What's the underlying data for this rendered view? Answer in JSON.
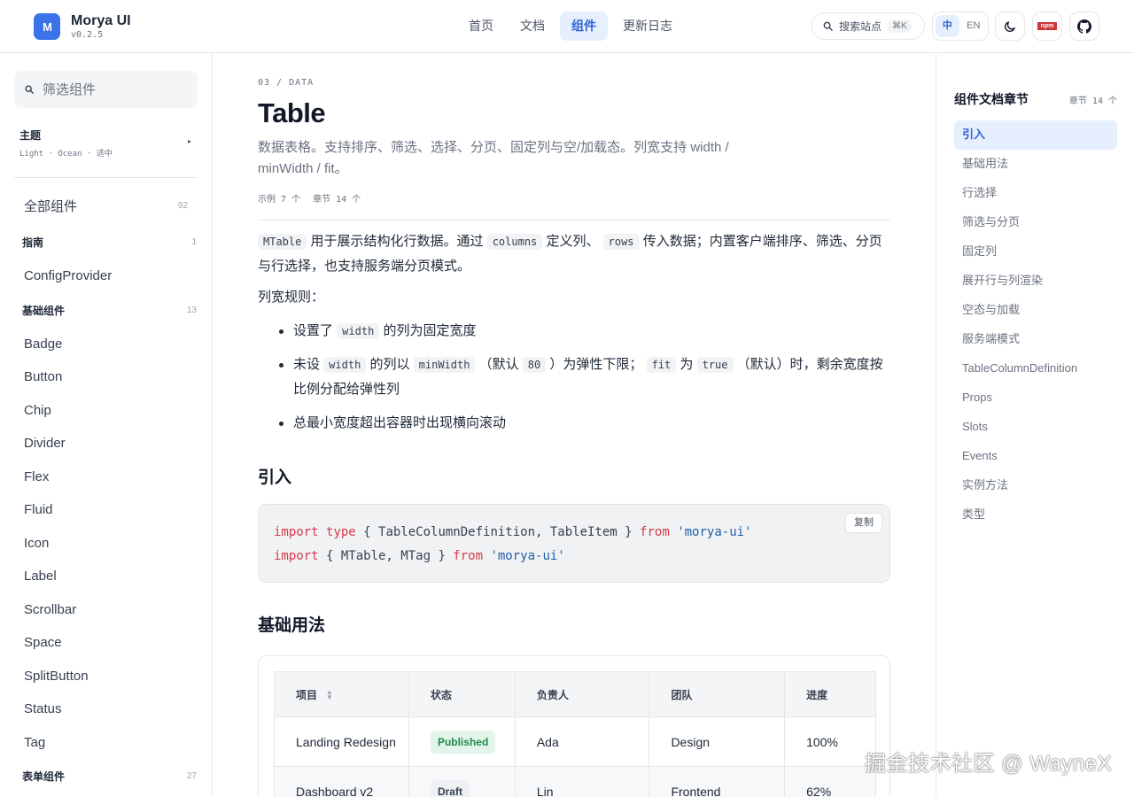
{
  "brand": {
    "logo": "M",
    "name": "Morya UI",
    "version": "v0.2.5"
  },
  "nav": [
    {
      "label": "首页",
      "active": false
    },
    {
      "label": "文档",
      "active": false
    },
    {
      "label": "组件",
      "active": true
    },
    {
      "label": "更新日志",
      "active": false
    }
  ],
  "search": {
    "label": "搜索站点",
    "shortcut": "⌘K"
  },
  "lang": {
    "zh": "中",
    "en": "EN"
  },
  "icons": {
    "theme": "moon-icon",
    "npm": "npm",
    "github": "github-icon"
  },
  "sidebar": {
    "filter_placeholder": "筛选组件",
    "theme_title": "主题",
    "theme_sub": "Light · Ocean · 适中",
    "all": {
      "label": "全部组件",
      "count": "92"
    },
    "groups": [
      {
        "label": "指南",
        "count": "1",
        "items": [
          "ConfigProvider"
        ]
      },
      {
        "label": "基础组件",
        "count": "13",
        "items": [
          "Badge",
          "Button",
          "Chip",
          "Divider",
          "Flex",
          "Fluid",
          "Icon",
          "Label",
          "Scrollbar",
          "Space",
          "SplitButton",
          "Status",
          "Tag"
        ]
      },
      {
        "label": "表单组件",
        "count": "27",
        "items": []
      }
    ]
  },
  "page": {
    "eyebrow": "03 / DATA",
    "title": "Table",
    "desc": "数据表格。支持排序、筛选、选择、分页、固定列与空/加载态。列宽支持 width / minWidth / fit。",
    "meta": {
      "examples": "示例 7 个",
      "sections": "章节 14 个"
    },
    "intro": {
      "c1": "MTable",
      "t1": " 用于展示结构化行数据。通过 ",
      "c2": "columns",
      "t2": " 定义列、 ",
      "c3": "rows",
      "t3": " 传入数据；内置客户端排序、筛选、分页与行选择，也支持服务端分页模式。"
    },
    "rules_title": "列宽规则：",
    "rules": {
      "r1a": "设置了 ",
      "r1c": "width",
      "r1b": " 的列为固定宽度",
      "r2a": "未设 ",
      "r2c1": "width",
      "r2b": " 的列以 ",
      "r2c2": "minWidth",
      "r2d": " （默认 ",
      "r2c3": "80",
      "r2e": " ）为弹性下限； ",
      "r2c4": "fit",
      "r2f": " 为 ",
      "r2c5": "true",
      "r2g": " （默认）时，剩余宽度按比例分配给弹性列",
      "r3": "总最小宽度超出容器时出现横向滚动"
    },
    "h_import": "引入",
    "code": {
      "l1_kw1": "import",
      "l1_kw2": "type",
      "l1_mid": " { TableColumnDefinition, TableItem } ",
      "l1_kw3": "from",
      "l1_str": "'morya-ui'",
      "l2_kw1": "import",
      "l2_mid": " { MTable, MTag } ",
      "l2_kw2": "from",
      "l2_str": "'morya-ui'",
      "copy": "复制"
    },
    "h_basic": "基础用法",
    "table": {
      "columns": [
        "项目",
        "状态",
        "负责人",
        "团队",
        "进度"
      ],
      "rows": [
        {
          "project": "Landing Redesign",
          "status": "Published",
          "owner": "Ada",
          "team": "Design",
          "progress": "100%"
        },
        {
          "project": "Dashboard v2",
          "status": "Draft",
          "owner": "Lin",
          "team": "Frontend",
          "progress": "62%"
        }
      ]
    }
  },
  "toc": {
    "title": "组件文档章节",
    "count": "章节 14 个",
    "items": [
      "引入",
      "基础用法",
      "行选择",
      "筛选与分页",
      "固定列",
      "展开行与列渲染",
      "空态与加载",
      "服务端模式",
      "TableColumnDefinition",
      "Props",
      "Slots",
      "Events",
      "实例方法",
      "类型"
    ],
    "active": "引入"
  },
  "watermark": "掘金技术社区 @ WayneX",
  "colors": {
    "accent": "#3b72e8",
    "accent_bg": "#e6effd",
    "published": "#1f8a4c",
    "keyword": "#d73a49",
    "string": "#1f5fa8"
  }
}
